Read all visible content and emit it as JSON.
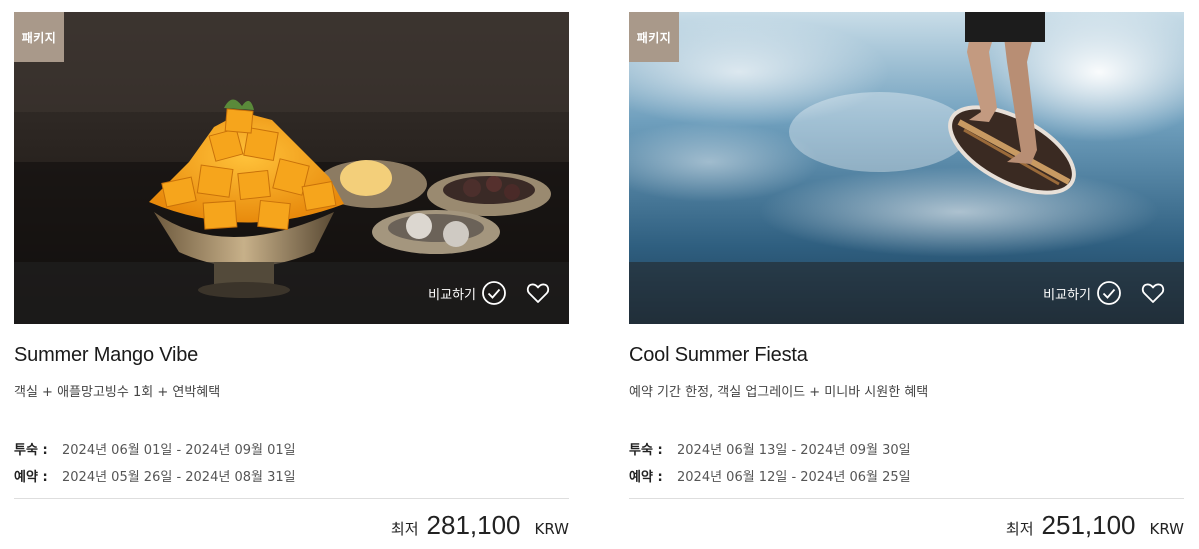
{
  "cards": [
    {
      "badge": "패키지",
      "compare_label": "비교하기",
      "title": "Summer Mango Vibe",
      "subtitle": "객실 + 애플망고빙수 1회 + 연박혜택",
      "stay_label": "투숙 :",
      "stay_dates": "2024년 06월 01일 - 2024년 09월 01일",
      "booking_label": "예약 :",
      "booking_dates": "2024년 05월 26일 - 2024년 08월 31일",
      "price_prefix": "최저",
      "price": "281,100",
      "currency": "KRW"
    },
    {
      "badge": "패키지",
      "compare_label": "비교하기",
      "title": "Cool Summer Fiesta",
      "subtitle": "예약 기간 한정, 객실 업그레이드 + 미니바 시원한 혜택",
      "stay_label": "투숙 :",
      "stay_dates": "2024년 06월 13일 - 2024년 09월 30일",
      "booking_label": "예약 :",
      "booking_dates": "2024년 06월 12일 - 2024년 06월 25일",
      "price_prefix": "최저",
      "price": "251,100",
      "currency": "KRW"
    }
  ],
  "colors": {
    "badge_bg": "#a9998a",
    "overlay": "rgba(35,35,35,0.55)",
    "text": "#222222"
  },
  "icons": [
    "check-circle-icon",
    "heart-icon"
  ]
}
